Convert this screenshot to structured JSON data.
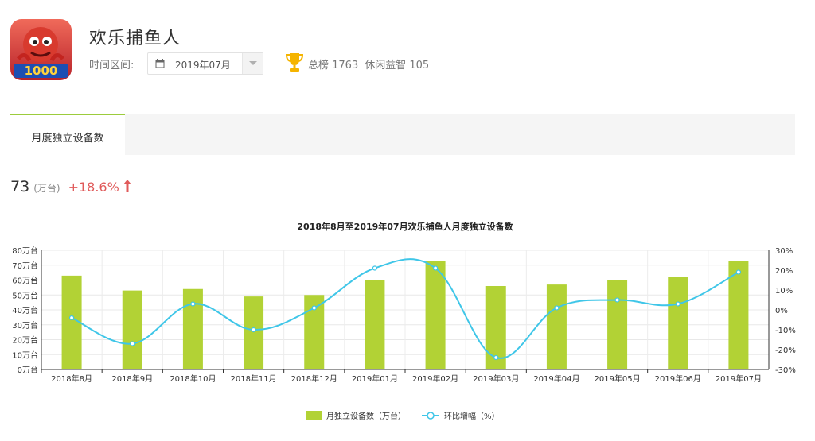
{
  "app": {
    "title": "欢乐捕鱼人",
    "icon_text": "1000",
    "icon_name": "game-app-icon"
  },
  "filter": {
    "period_label": "时间区间:",
    "period_value": "2019年07月",
    "calendar_icon": "calendar-icon",
    "dropdown_icon": "chevron-down-icon"
  },
  "ranking": {
    "icon": "trophy-icon",
    "overall": "总榜 1763",
    "category": "休闲益智 105"
  },
  "tabs": [
    {
      "label": "月度独立设备数",
      "active": true
    }
  ],
  "metric": {
    "value": "73",
    "unit": "(万台)",
    "change": "+18.6%",
    "trend_icon": "arrow-up-icon"
  },
  "colors": {
    "bar": "#b2d235",
    "line": "#3fc6e8",
    "accent_green": "#9ccc3d",
    "change_red": "#e05a5a"
  },
  "chart_data": {
    "type": "bar",
    "title": "2018年8月至2019年07月欢乐捕鱼人月度独立设备数",
    "categories": [
      "2018年8月",
      "2018年9月",
      "2018年10月",
      "2018年11月",
      "2018年12月",
      "2019年01月",
      "2019年02月",
      "2019年03月",
      "2019年04月",
      "2019年05月",
      "2019年06月",
      "2019年07月"
    ],
    "series": [
      {
        "name": "月独立设备数（万台）",
        "type": "bar",
        "axis": "left",
        "values": [
          63,
          53,
          54,
          49,
          50,
          60,
          73,
          56,
          57,
          60,
          62,
          73
        ]
      },
      {
        "name": "环比增幅（%）",
        "type": "line",
        "axis": "right",
        "values": [
          -4,
          -17,
          3,
          -10,
          1,
          21,
          21,
          -24,
          1,
          5,
          3,
          19
        ]
      }
    ],
    "y_left": {
      "min": 0,
      "max": 80,
      "step": 10,
      "tick_suffix": "万台"
    },
    "y_right": {
      "min": -30,
      "max": 30,
      "step": 10,
      "tick_suffix": "%"
    },
    "grid": true,
    "legend_position": "bottom"
  }
}
